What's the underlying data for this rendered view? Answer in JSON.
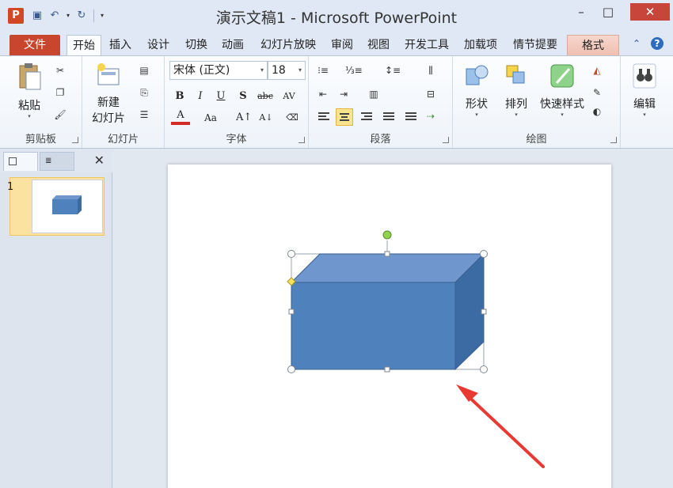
{
  "app": {
    "logo_letter": "P",
    "title": "演示文稿1 - Microsoft PowerPoint"
  },
  "window_controls": {
    "minimize": "–",
    "maximize": "□",
    "close": "✕"
  },
  "tabs": {
    "file": "文件",
    "items": [
      "开始",
      "插入",
      "设计",
      "切换",
      "动画",
      "幻灯片放映",
      "审阅",
      "视图",
      "开发工具",
      "加载项",
      "情节提要"
    ],
    "format": "格式",
    "active": "开始"
  },
  "ribbon": {
    "clipboard": {
      "paste_label": "粘贴",
      "group_label": "剪贴板"
    },
    "slides": {
      "new_slide_label_1": "新建",
      "new_slide_label_2": "幻灯片",
      "group_label": "幻灯片"
    },
    "font": {
      "font_name": "宋体 (正文)",
      "font_size": "18",
      "group_label": "字体"
    },
    "paragraph": {
      "group_label": "段落"
    },
    "drawing": {
      "shapes_label": "形状",
      "arrange_label": "排列",
      "quick_styles_label": "快速样式",
      "group_label": "绘图"
    },
    "editing": {
      "edit_label": "编辑"
    }
  },
  "slides_panel": {
    "slide_number": "1"
  },
  "colors": {
    "accent_file_tab": "#c8462e",
    "shape_fill": "#4f81bd",
    "shape_top": "#6f97cd",
    "shape_side": "#3c6aa3",
    "arrow": "#e83a33",
    "selection_handle_rotate": "#8fd34f",
    "selection_handle_adjust": "#f5e15a"
  }
}
